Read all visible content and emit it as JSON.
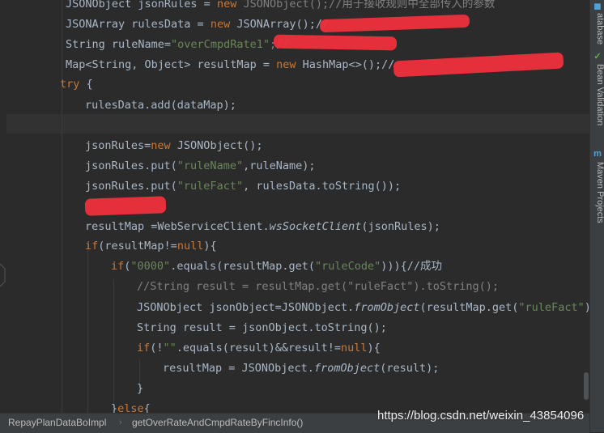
{
  "editor": {
    "lines": [
      {
        "tokens": [
          {
            "t": "JSONObject jsonRules = ",
            "c": "plain"
          },
          {
            "t": "new",
            "c": "kw"
          },
          {
            "t": " JSONObject();//用于接收规则中全部传入的参数",
            "c": "cm"
          }
        ]
      },
      {
        "tokens": [
          {
            "t": "JSONArray rulesData = ",
            "c": "plain"
          },
          {
            "t": "new",
            "c": "kw"
          },
          {
            "t": " JSONArray();//",
            "c": "plain"
          }
        ]
      },
      {
        "tokens": [
          {
            "t": "String ruleName=",
            "c": "plain"
          },
          {
            "t": "\"overCmpdRate1\"",
            "c": "str"
          },
          {
            "t": ";//",
            "c": "cm"
          }
        ]
      },
      {
        "tokens": [
          {
            "t": "Map<String, Object> resultMap = ",
            "c": "plain"
          },
          {
            "t": "new",
            "c": "kw"
          },
          {
            "t": " HashMap<>();//",
            "c": "plain"
          }
        ]
      },
      {
        "tokens": [
          {
            "t": "try",
            "c": "kw"
          },
          {
            "t": " {",
            "c": "plain"
          }
        ]
      },
      {
        "tokens": [
          {
            "t": "rulesData.add(dataMap);",
            "c": "plain"
          }
        ]
      },
      {
        "tokens": []
      },
      {
        "tokens": [
          {
            "t": "jsonRules=",
            "c": "plain"
          },
          {
            "t": "new",
            "c": "kw"
          },
          {
            "t": " JSONObject();",
            "c": "plain"
          }
        ]
      },
      {
        "tokens": [
          {
            "t": "jsonRules.put(",
            "c": "plain"
          },
          {
            "t": "\"ruleName\"",
            "c": "str"
          },
          {
            "t": ",ruleName);",
            "c": "plain"
          }
        ]
      },
      {
        "tokens": [
          {
            "t": "jsonRules.put(",
            "c": "plain"
          },
          {
            "t": "\"ruleFact\"",
            "c": "str"
          },
          {
            "t": ", rulesData.toString());",
            "c": "plain"
          }
        ]
      },
      {
        "tokens": []
      },
      {
        "tokens": [
          {
            "t": "resultMap =WebServiceClient.",
            "c": "plain"
          },
          {
            "t": "wsSocketClient",
            "c": "it"
          },
          {
            "t": "(jsonRules);",
            "c": "plain"
          }
        ]
      },
      {
        "tokens": [
          {
            "t": "if",
            "c": "kw"
          },
          {
            "t": "(resultMap!=",
            "c": "plain"
          },
          {
            "t": "null",
            "c": "kw"
          },
          {
            "t": "){",
            "c": "plain"
          }
        ]
      },
      {
        "tokens": [
          {
            "t": "if",
            "c": "kw"
          },
          {
            "t": "(",
            "c": "plain"
          },
          {
            "t": "\"0000\"",
            "c": "str"
          },
          {
            "t": ".equals(resultMap.get(",
            "c": "plain"
          },
          {
            "t": "\"ruleCode\"",
            "c": "str"
          },
          {
            "t": "))){//成功",
            "c": "plain"
          }
        ]
      },
      {
        "tokens": [
          {
            "t": "//String result = resultMap.get(\"ruleFact\").toString();",
            "c": "cm"
          }
        ]
      },
      {
        "tokens": [
          {
            "t": "JSONObject jsonObject=JSONObject.",
            "c": "plain"
          },
          {
            "t": "fromObject",
            "c": "it"
          },
          {
            "t": "(resultMap.get(",
            "c": "plain"
          },
          {
            "t": "\"ruleFact\"",
            "c": "str"
          },
          {
            "t": "));",
            "c": "plain"
          }
        ]
      },
      {
        "tokens": [
          {
            "t": "String result = jsonObject.toString();",
            "c": "plain"
          }
        ]
      },
      {
        "tokens": [
          {
            "t": "if",
            "c": "kw"
          },
          {
            "t": "(!",
            "c": "plain"
          },
          {
            "t": "\"\"",
            "c": "str"
          },
          {
            "t": ".equals(result)&&result!=",
            "c": "plain"
          },
          {
            "t": "null",
            "c": "kw"
          },
          {
            "t": "){",
            "c": "plain"
          }
        ]
      },
      {
        "tokens": [
          {
            "t": "resultMap = JSONObject.",
            "c": "plain"
          },
          {
            "t": "fromObject",
            "c": "it"
          },
          {
            "t": "(result);",
            "c": "plain"
          }
        ]
      },
      {
        "tokens": [
          {
            "t": "}",
            "c": "plain"
          }
        ]
      },
      {
        "tokens": [
          {
            "t": "}",
            "c": "plain"
          },
          {
            "t": "else",
            "c": "kw"
          },
          {
            "t": "{",
            "c": "plain"
          }
        ]
      }
    ]
  },
  "right_panel": {
    "tabs": [
      {
        "label": "atabase",
        "icon": "database-icon",
        "glyph": "◼"
      },
      {
        "label": "Bean Validation",
        "icon": "bean-validation-icon",
        "glyph": "✓"
      },
      {
        "label": "Maven Projects",
        "icon": "maven-icon",
        "glyph": "m"
      }
    ]
  },
  "breadcrumb": {
    "items": [
      "RepayPlanDataBoImpl",
      "getOverRateAndCmpdRateByFincInfo()"
    ]
  },
  "watermark": "https://blog.csdn.net/weixin_43854096",
  "colors": {
    "keyword": "#cc7832",
    "string": "#6a8759",
    "comment": "#808080",
    "text": "#a9b7c6",
    "redaction": "#ef2f3c"
  }
}
